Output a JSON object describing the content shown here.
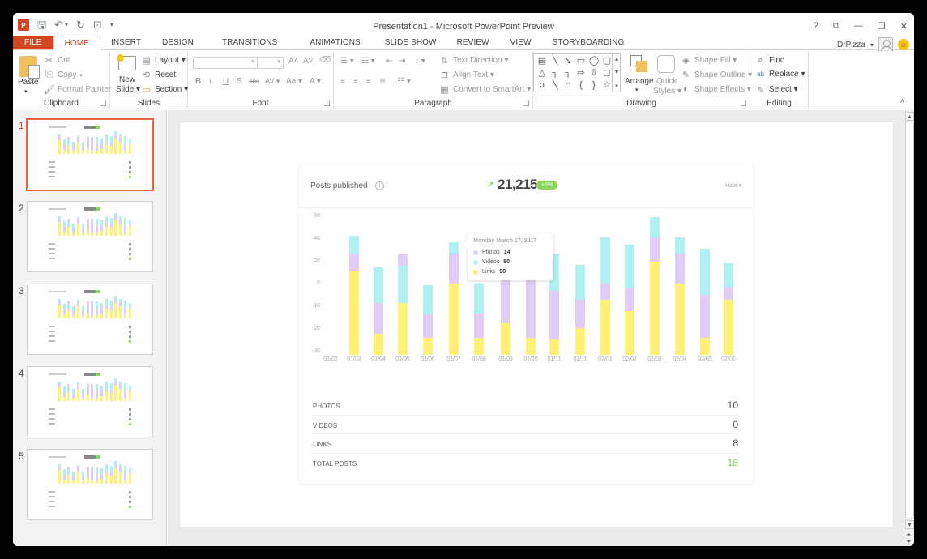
{
  "window": {
    "title": "Presentation1 - Microsoft PowerPoint Preview",
    "controls": [
      "?",
      "⧉",
      "—",
      "❐",
      "✕"
    ],
    "user": "DrPizza",
    "user_dropdown": "▾"
  },
  "qat": {
    "app_logo": "P",
    "save": "🖫",
    "undo": "↶",
    "undo_dropdown": "▾",
    "redo": "↻",
    "slideshow": "⊡",
    "customize": "▾"
  },
  "tabs": [
    {
      "label": "FILE"
    },
    {
      "label": "HOME"
    },
    {
      "label": "INSERT"
    },
    {
      "label": "DESIGN"
    },
    {
      "label": "TRANSITIONS"
    },
    {
      "label": "ANIMATIONS"
    },
    {
      "label": "SLIDE SHOW"
    },
    {
      "label": "REVIEW"
    },
    {
      "label": "VIEW"
    },
    {
      "label": "STORYBOARDING"
    }
  ],
  "ribbon": {
    "clipboard": {
      "label": "Clipboard",
      "paste": "Paste",
      "cut": "Cut",
      "copy": "Copy",
      "format_painter": "Format Painter"
    },
    "slides": {
      "label": "Slides",
      "new_slide_1": "New",
      "new_slide_2": "Slide ▾",
      "layout": "Layout ▾",
      "reset": "Reset",
      "section": "Section ▾"
    },
    "font": {
      "label": "Font",
      "font_name": "",
      "font_size": "",
      "bold": "B",
      "italic": "I",
      "underline": "U",
      "shadow": "S",
      "strike": "abc",
      "spacing": "AV ▾",
      "case": "Aa ▾",
      "color": "A ▾",
      "grow": "A˄",
      "shrink": "A˅"
    },
    "paragraph": {
      "label": "Paragraph",
      "text_direction": "Text Direction ▾",
      "align_text": "Align Text ▾",
      "smartart": "Convert to SmartArt ▾"
    },
    "drawing": {
      "label": "Drawing",
      "arrange": "Arrange",
      "quick_styles_1": "Quick",
      "quick_styles_2": "Styles ▾",
      "shape_fill": "Shape Fill ▾",
      "shape_outline": "Shape Outline ▾",
      "shape_effects": "Shape Effects ▾",
      "shapes": [
        "▤",
        "╲",
        "↘",
        "▭",
        "◯",
        "▢",
        "△",
        "┐",
        "┐",
        "⇨",
        "⇩",
        "◻",
        "ↄ",
        "╲",
        "∩",
        "{",
        "}",
        "☆"
      ]
    },
    "editing": {
      "label": "Editing",
      "find": "Find",
      "replace": "Replace ▾",
      "select": "Select ▾"
    }
  },
  "slides_panel": {
    "numbers": [
      "1",
      "2",
      "3",
      "4",
      "5"
    ],
    "selected": 1
  },
  "slide": {
    "card": {
      "title": "Posts published",
      "info_icon": "i",
      "trend_icon": "↗",
      "total": "21,215",
      "badge": "+5%",
      "hide_label": "Hide ▾"
    },
    "tooltip": {
      "title": "Monday March 17, 2017",
      "rows": [
        {
          "label": "Photos",
          "value": "14"
        },
        {
          "label": "Videos",
          "value": "90"
        },
        {
          "label": "Links",
          "value": "90"
        }
      ]
    },
    "stats": [
      {
        "label": "PHOTOS",
        "value": "10"
      },
      {
        "label": "VIDEOS",
        "value": "0"
      },
      {
        "label": "LINKS",
        "value": "8"
      },
      {
        "label": "TOTAL POSTS",
        "value": "18"
      }
    ]
  },
  "colors": {
    "accent": "#d24726",
    "links": "#fff176",
    "photos": "#e1cdf5",
    "videos": "#b0f0f2",
    "positive": "#7ccc4c"
  },
  "chart_data": {
    "type": "bar",
    "stacked": true,
    "title": "Posts published",
    "xlabel": "",
    "ylabel": "",
    "y_tick_labels": [
      "80",
      "40",
      "20",
      "0",
      "-10",
      "-20",
      "-30"
    ],
    "ylim": [
      -30,
      80
    ],
    "categories": [
      "01/02",
      "01/03",
      "01/04",
      "01/05",
      "01/06",
      "01/07",
      "01/08",
      "01/09",
      "01/10",
      "01/11",
      "02/11",
      "02/01",
      "02/02",
      "02/03",
      "02/04",
      "02/05",
      "02/06"
    ],
    "note": "Each series lists the top value of that stacked segment (axis units, piecewise-linear between labeled ticks); null = bar absent. Stack order bottom-to-top per bar is given in stack_order.",
    "stack_order": [
      null,
      [
        "Links",
        "Photos",
        "Videos"
      ],
      [
        "Links",
        "Photos",
        "Videos"
      ],
      [
        "Links",
        "Videos",
        "Photos"
      ],
      [
        "Links",
        "Photos",
        "Videos"
      ],
      [
        "Links",
        "Photos",
        "Videos"
      ],
      [
        "Links",
        "Photos",
        "Videos"
      ],
      [
        "Links",
        "Photos",
        "Videos"
      ],
      [
        "Links",
        "Photos",
        "Videos"
      ],
      [
        "Links",
        "Photos",
        "Videos"
      ],
      [
        "Links",
        "Photos",
        "Videos"
      ],
      [
        "Links",
        "Photos",
        "Videos"
      ],
      [
        "Links",
        "Photos",
        "Videos"
      ],
      [
        "Links",
        "Photos",
        "Videos"
      ],
      [
        "Links",
        "Photos",
        "Videos"
      ],
      [
        "Links",
        "Photos",
        "Videos"
      ],
      [
        "Links",
        "Photos",
        "Videos"
      ]
    ],
    "series": [
      {
        "name": "Links",
        "values": [
          null,
          11,
          -22,
          -8.5,
          -24,
          0,
          -24,
          -17.5,
          -24,
          -24.5,
          -19.5,
          -7,
          -12,
          20,
          0,
          -24,
          -7
        ]
      },
      {
        "name": "Photos",
        "values": [
          null,
          27,
          -8.5,
          27,
          -13.5,
          27,
          -13,
          30,
          30,
          -3,
          -7,
          0,
          -2,
          43,
          27,
          -5,
          -1.5
        ]
      },
      {
        "name": "Videos",
        "values": [
          null,
          45,
          15,
          16,
          -0.5,
          37,
          0,
          30,
          30,
          27,
          17,
          42,
          35,
          78,
          42,
          31,
          18
        ]
      }
    ],
    "tooltip_category": "01/09",
    "legend": "tooltip"
  }
}
